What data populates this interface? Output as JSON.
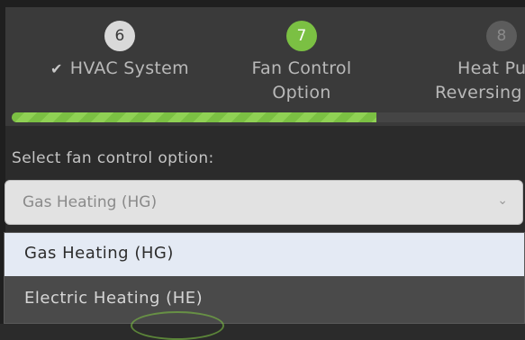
{
  "stepper": {
    "steps": [
      {
        "number": "6",
        "label_line1": "HVAC System",
        "label_line2": "",
        "state": "completed"
      },
      {
        "number": "7",
        "label_line1": "Fan Control",
        "label_line2": "Option",
        "state": "active"
      },
      {
        "number": "8",
        "label_line1": "Heat Pu",
        "label_line2": "Reversing",
        "state": "upcoming"
      }
    ],
    "progress_fraction": 0.71
  },
  "form": {
    "label": "Select fan control option:",
    "selected_value": "Gas Heating (HG)",
    "options": [
      "Gas Heating (HG)",
      "Electric Heating (HE)"
    ],
    "highlighted_option": "Gas Heating (HG)"
  },
  "icons": {
    "check": "check-icon",
    "chevron": "chevron-down-icon"
  },
  "colors": {
    "accent": "#7bc043",
    "highlight": "#e4eaf4"
  }
}
